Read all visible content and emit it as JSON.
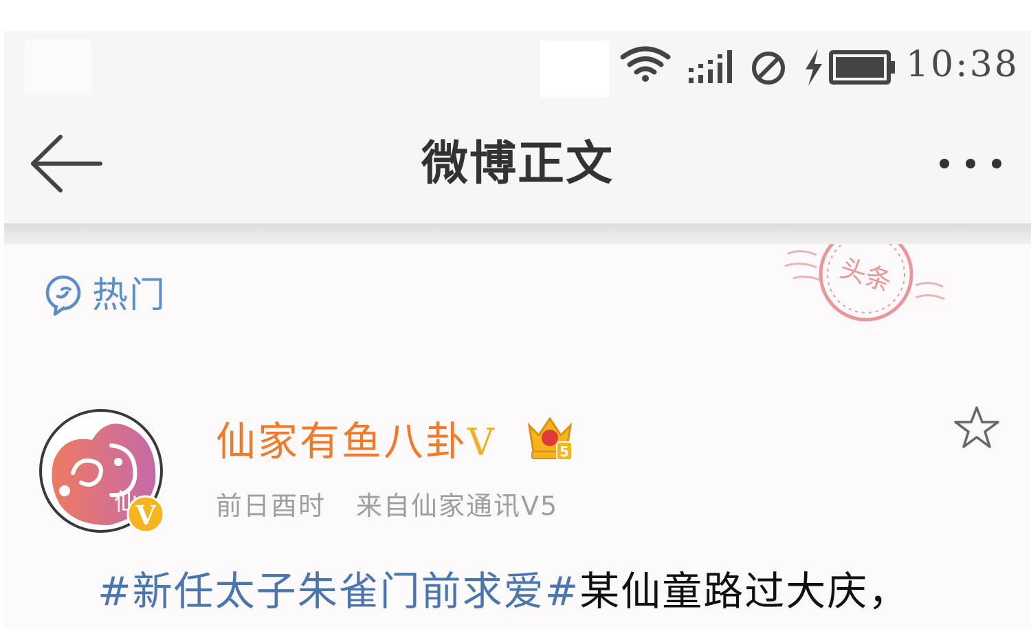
{
  "status_bar": {
    "time": "10:38",
    "icons": [
      "wifi-icon",
      "signal-icon",
      "do-not-disturb-icon",
      "charging-icon",
      "battery-icon"
    ]
  },
  "nav": {
    "title": "微博正文",
    "back_icon": "arrow-left-icon",
    "more_icon": "more-dots-icon"
  },
  "hot": {
    "label": "热门",
    "icon": "hot-chat-icon"
  },
  "stamp": {
    "text": "头条",
    "color": "#d94a4a"
  },
  "post": {
    "author": "仙家有鱼八卦",
    "verified_mark": "V",
    "avatar_text": "仙",
    "avatar_badge": "V",
    "vip_level": "5",
    "time": "前日酉时",
    "source": "来自仙家通讯V5",
    "topic": "#新任太子朱雀门前求爱#",
    "text": "某仙童路过大庆，"
  },
  "colors": {
    "username": "#ef7a2a",
    "topic": "#4a76ad",
    "hot_label": "#5a8ec8",
    "meta": "#9e9e9e"
  }
}
